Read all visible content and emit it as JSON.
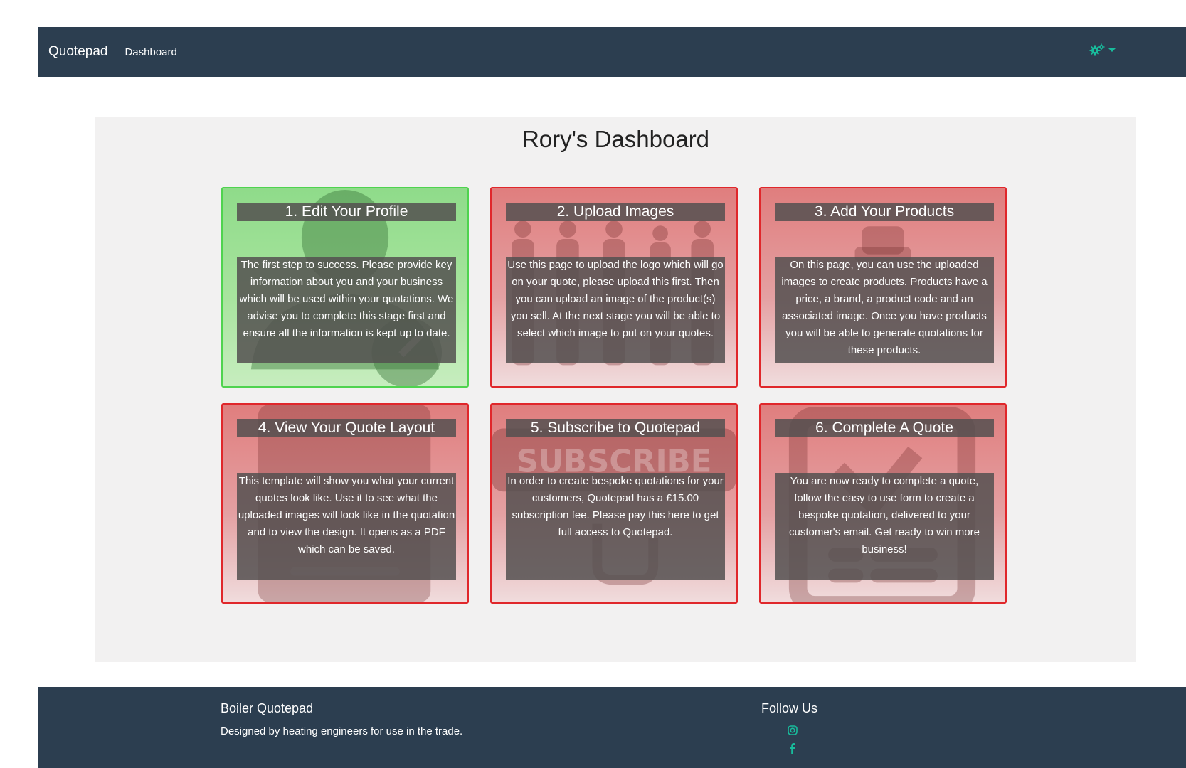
{
  "navbar": {
    "brand": "Quotepad",
    "links": [
      "Dashboard"
    ],
    "settings_icon": "gears-icon",
    "accent_color": "#18bc9c",
    "background": "#2c3e50"
  },
  "main": {
    "title": "Rory's Dashboard",
    "cards": [
      {
        "title": "1. Edit Your Profile",
        "body": "The first step to success. Please provide key information about you and your business which will be used within your quotations. We advise you to complete this stage first and ensure all the information is kept up to date.",
        "status": "active",
        "background_icon": "user-edit-icon"
      },
      {
        "title": "2. Upload Images",
        "body": "Use this page to upload the logo which will go on your quote, please upload this first. Then you can upload an image of the product(s) you sell. At the next stage you will be able to select which image to put on your quotes.",
        "status": "incomplete",
        "background_icon": "people-silhouettes-icon"
      },
      {
        "title": "3. Add Your Products",
        "body": "On this page, you can use the uploaded images to create products. Products have a price, a brand, a product code and an associated image. Once you have products you will be able to generate quotations for these products.",
        "status": "incomplete",
        "background_icon": "clipboard-icon"
      },
      {
        "title": "4. View Your Quote Layout",
        "body": "This template will show you what your current quotes look like. Use it to see what the uploaded images will look like in the quotation and to view the design. It opens as a PDF which can be saved.",
        "status": "incomplete",
        "background_icon": "document-icon"
      },
      {
        "title": "5. Subscribe to Quotepad",
        "body": "In order to create bespoke quotations for your customers, Quotepad has a £15.00 subscription fee. Please pay this here to get full access to Quotepad.",
        "status": "incomplete",
        "background_icon": "subscribe-button-icon",
        "background_text": "SUBSCRIBE"
      },
      {
        "title": "6. Complete A Quote",
        "body": "You are now ready to complete a quote, follow the easy to use form to create a bespoke quotation, delivered to your customer's email. Get ready to win more business!",
        "status": "incomplete",
        "background_icon": "checklist-icon"
      }
    ],
    "colors": {
      "active_border": "#4fd34f",
      "incomplete_border": "#e0272b"
    }
  },
  "footer": {
    "brand_title": "Boiler Quotepad",
    "tagline": "Designed by heating engineers for use in the trade.",
    "follow_title": "Follow Us",
    "social_icons": [
      "instagram-icon",
      "facebook-icon"
    ]
  }
}
